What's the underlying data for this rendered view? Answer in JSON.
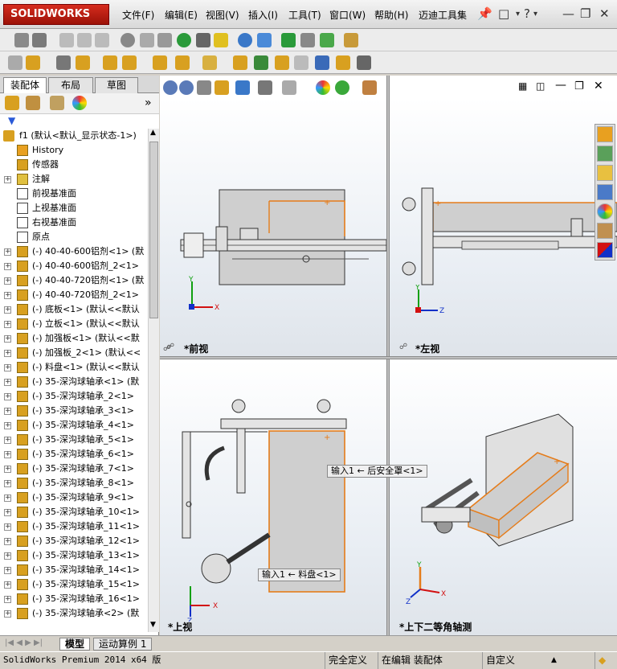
{
  "app": {
    "logo": "SOLIDWORKS"
  },
  "menu": [
    "文件(F)",
    "编辑(E)",
    "视图(V)",
    "插入(I)",
    "工具(T)",
    "窗口(W)",
    "帮助(H)",
    "迈迪工具集"
  ],
  "panel_tabs": [
    "装配体",
    "布局",
    "草图"
  ],
  "tree": {
    "root": "f1  (默认<默认_显示状态-1>)",
    "items": [
      {
        "label": "History",
        "icon": "history-icon",
        "exp": false
      },
      {
        "label": "传感器",
        "icon": "sensor-icon",
        "exp": false
      },
      {
        "label": "注解",
        "icon": "annotation-icon",
        "exp": true
      },
      {
        "label": "前视基准面",
        "icon": "plane-icon",
        "exp": false
      },
      {
        "label": "上视基准面",
        "icon": "plane-icon",
        "exp": false
      },
      {
        "label": "右视基准面",
        "icon": "plane-icon",
        "exp": false
      },
      {
        "label": "原点",
        "icon": "origin-icon",
        "exp": false
      },
      {
        "label": "(-) 40-40-600铝剂<1> (默",
        "icon": "part-icon",
        "exp": true
      },
      {
        "label": "(-) 40-40-600铝剂_2<1>",
        "icon": "part-icon",
        "exp": true
      },
      {
        "label": "(-) 40-40-720铝剂<1> (默",
        "icon": "part-icon",
        "exp": true
      },
      {
        "label": "(-) 40-40-720铝剂_2<1>",
        "icon": "part-icon",
        "exp": true
      },
      {
        "label": "(-) 底板<1> (默认<<默认",
        "icon": "part-icon",
        "exp": true
      },
      {
        "label": "(-) 立板<1> (默认<<默认",
        "icon": "part-icon",
        "exp": true
      },
      {
        "label": "(-) 加强板<1> (默认<<默",
        "icon": "part-icon",
        "exp": true
      },
      {
        "label": "(-) 加强板_2<1> (默认<<",
        "icon": "part-icon",
        "exp": true
      },
      {
        "label": "(-) 料盘<1> (默认<<默认",
        "icon": "part-icon",
        "exp": true
      },
      {
        "label": "(-) 35-深沟球轴承<1> (默",
        "icon": "part-icon",
        "exp": true
      },
      {
        "label": "(-) 35-深沟球轴承_2<1>",
        "icon": "part-icon",
        "exp": true
      },
      {
        "label": "(-) 35-深沟球轴承_3<1>",
        "icon": "part-icon",
        "exp": true
      },
      {
        "label": "(-) 35-深沟球轴承_4<1>",
        "icon": "part-icon",
        "exp": true
      },
      {
        "label": "(-) 35-深沟球轴承_5<1>",
        "icon": "part-icon",
        "exp": true
      },
      {
        "label": "(-) 35-深沟球轴承_6<1>",
        "icon": "part-icon",
        "exp": true
      },
      {
        "label": "(-) 35-深沟球轴承_7<1>",
        "icon": "part-icon",
        "exp": true
      },
      {
        "label": "(-) 35-深沟球轴承_8<1>",
        "icon": "part-icon",
        "exp": true
      },
      {
        "label": "(-) 35-深沟球轴承_9<1>",
        "icon": "part-icon",
        "exp": true
      },
      {
        "label": "(-) 35-深沟球轴承_10<1>",
        "icon": "part-icon",
        "exp": true
      },
      {
        "label": "(-) 35-深沟球轴承_11<1>",
        "icon": "part-icon",
        "exp": true
      },
      {
        "label": "(-) 35-深沟球轴承_12<1>",
        "icon": "part-icon",
        "exp": true
      },
      {
        "label": "(-) 35-深沟球轴承_13<1>",
        "icon": "part-icon",
        "exp": true
      },
      {
        "label": "(-) 35-深沟球轴承_14<1>",
        "icon": "part-icon",
        "exp": true
      },
      {
        "label": "(-) 35-深沟球轴承_15<1>",
        "icon": "part-icon",
        "exp": true
      },
      {
        "label": "(-) 35-深沟球轴承_16<1>",
        "icon": "part-icon",
        "exp": true
      },
      {
        "label": "(-) 35-深沟球轴承<2> (默",
        "icon": "part-icon",
        "exp": true
      }
    ]
  },
  "bottom_tabs": [
    "模型",
    "运动算例 1"
  ],
  "status": {
    "product": "SolidWorks Premium 2014 x64 版",
    "defined": "完全定义",
    "editing": "在编辑 装配体",
    "custom": "自定义"
  },
  "viewports": {
    "front": "*前视",
    "left": "*左视",
    "top": "*上视",
    "iso": "*上下二等角轴测"
  },
  "callouts": {
    "c1": "输入1 ← 后安全罩<1>",
    "c2": "输入1 ← 料盘<1>"
  },
  "axes": {
    "x": "X",
    "y": "Y",
    "z": "Z"
  },
  "colors": {
    "accent": "#e57c1a",
    "logo_red": "#c8241a",
    "x_axis": "#d21010",
    "y_axis": "#10a010",
    "z_axis": "#1030c8"
  }
}
